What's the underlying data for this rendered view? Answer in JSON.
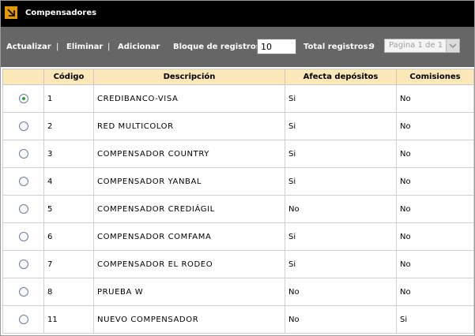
{
  "window": {
    "title": "Compensadores",
    "title_icon": "arrow-corner-icon",
    "accent": "#e09a00"
  },
  "toolbar": {
    "actualizar": "Actualizar",
    "eliminar": "Eliminar",
    "adicionar": "Adicionar",
    "separator": "|",
    "block_label": "Bloque de registros:",
    "block_value": "10",
    "total_label": "Total registros:",
    "total_value": "9",
    "page_select": "Pagina 1 de 1"
  },
  "table": {
    "header_color": "#fbe7b7",
    "columns": [
      "",
      "Código",
      "Descripción",
      "Afecta depósitos",
      "Comisiones"
    ],
    "rows": [
      {
        "selected": true,
        "codigo": "1",
        "descripcion": "CREDIBANCO-VISA",
        "afecta": "Si",
        "comisiones": "No"
      },
      {
        "selected": false,
        "codigo": "2",
        "descripcion": "RED MULTICOLOR",
        "afecta": "Si",
        "comisiones": "No"
      },
      {
        "selected": false,
        "codigo": "3",
        "descripcion": "COMPENSADOR COUNTRY",
        "afecta": "Si",
        "comisiones": "No"
      },
      {
        "selected": false,
        "codigo": "4",
        "descripcion": "COMPENSADOR YANBAL",
        "afecta": "Si",
        "comisiones": "No"
      },
      {
        "selected": false,
        "codigo": "5",
        "descripcion": "COMPENSADOR CREDIÁGIL",
        "afecta": "No",
        "comisiones": "No"
      },
      {
        "selected": false,
        "codigo": "6",
        "descripcion": "COMPENSADOR COMFAMA",
        "afecta": "Si",
        "comisiones": "No"
      },
      {
        "selected": false,
        "codigo": "7",
        "descripcion": "COMPENSADOR EL RODEO",
        "afecta": "Si",
        "comisiones": "No"
      },
      {
        "selected": false,
        "codigo": "8",
        "descripcion": "PRUEBA W",
        "afecta": "No",
        "comisiones": "No"
      },
      {
        "selected": false,
        "codigo": "11",
        "descripcion": "NUEVO COMPENSADOR",
        "afecta": "No",
        "comisiones": "Si"
      }
    ]
  }
}
